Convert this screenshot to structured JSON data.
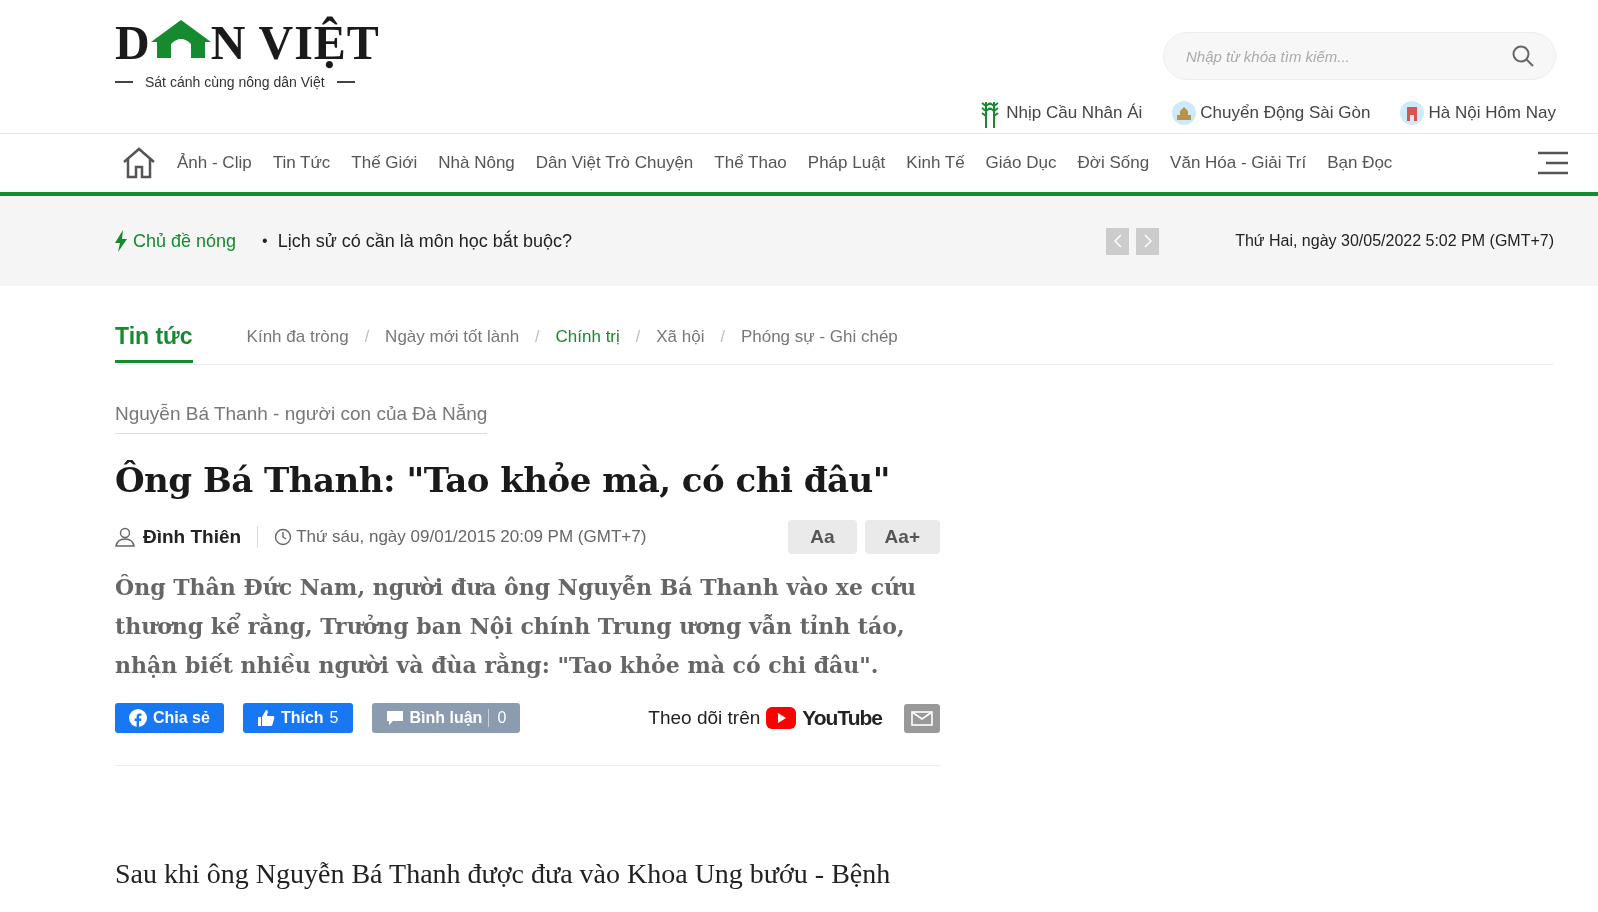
{
  "logo": {
    "left": "D",
    "right": "N VIỆT",
    "tagline": "Sát cánh cùng nông dân Việt"
  },
  "search": {
    "placeholder": "Nhập từ khóa tìm kiếm..."
  },
  "quick_links": [
    {
      "kind": "wheat",
      "label": "Nhịp Cầu Nhân Ái"
    },
    {
      "kind": "saigon",
      "label": "Chuyển Động Sài Gòn"
    },
    {
      "kind": "hanoi",
      "label": "Hà Nội Hôm Nay"
    }
  ],
  "nav": {
    "items": [
      "Ảnh - Clip",
      "Tin Tức",
      "Thế Giới",
      "Nhà Nông",
      "Dân Việt Trò Chuyện",
      "Thể Thao",
      "Pháp Luật",
      "Kinh Tế",
      "Giáo Dục",
      "Đời Sống",
      "Văn Hóa - Giải Trí",
      "Bạn Đọc"
    ]
  },
  "hot_topics": {
    "label": "Chủ đề nóng",
    "bullet": "•",
    "headline": "Lịch sử có cần là môn học bắt buộc?",
    "datetime": "Thứ Hai, ngày 30/05/2022 5:02 PM (GMT+7)"
  },
  "section": {
    "title": "Tin tức",
    "subcategories": [
      {
        "label": "Kính đa tròng",
        "selected": false
      },
      {
        "label": "Ngày mới tốt lành",
        "selected": false
      },
      {
        "label": "Chính trị",
        "selected": true
      },
      {
        "label": "Xã hội",
        "selected": false
      },
      {
        "label": "Phóng sự - Ghi chép",
        "selected": false
      }
    ],
    "separator": "/"
  },
  "article": {
    "series": "Nguyễn Bá Thanh - người con của Đà Nẵng",
    "title": "Ông Bá Thanh: \"Tao khỏe mà, có chi đâu\"",
    "author": "Đình Thiên",
    "date": "Thứ sáu, ngày 09/01/2015 20:09 PM (GMT+7)",
    "font_buttons": [
      "Aa",
      "Aa+"
    ],
    "sapo": "Ông Thân Đức Nam, người đưa ông Nguyễn Bá Thanh vào xe cứu thương kể rằng, Trưởng ban Nội chính Trung ương vẫn tỉnh táo, nhận biết nhiều người và đùa rằng: \"Tao khỏe mà có chi đâu\".",
    "share": {
      "label": "Chia sẻ"
    },
    "like": {
      "label": "Thích",
      "count": "5"
    },
    "comment": {
      "label": "Bình luận",
      "count": "0"
    },
    "follow": {
      "label": "Theo dõi trên",
      "brand": "YouTube"
    },
    "body": "Sau khi ông Nguyễn Bá Thanh được đưa vào Khoa Ung bướu - Bệnh"
  }
}
